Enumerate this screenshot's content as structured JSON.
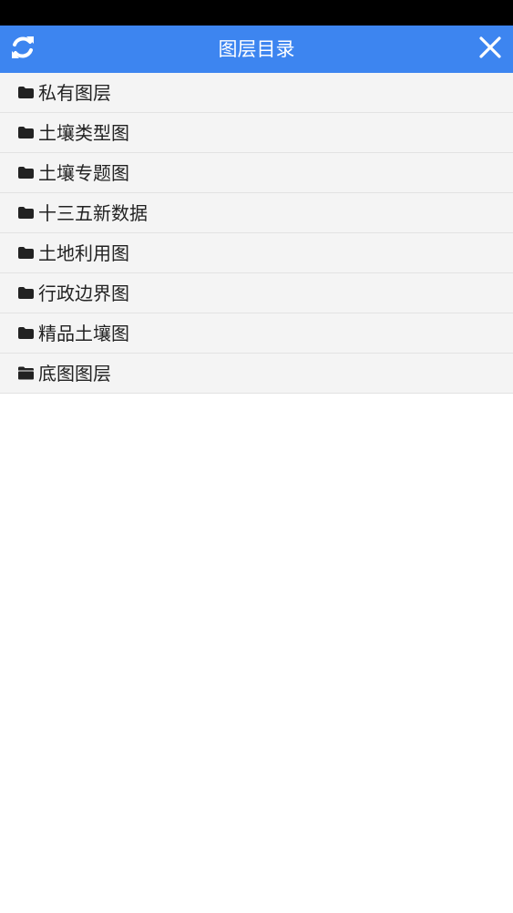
{
  "header": {
    "title": "图层目录",
    "refresh_icon": "refresh-icon",
    "close_icon": "close-icon"
  },
  "colors": {
    "header_bg": "#3d85f0",
    "status_bar": "#000000",
    "item_bg": "#f4f4f4",
    "divider": "#e2e2e2",
    "text": "#222222"
  },
  "layers": {
    "items": [
      {
        "label": "私有图层",
        "icon": "folder-icon"
      },
      {
        "label": "土壤类型图",
        "icon": "folder-icon"
      },
      {
        "label": "土壤专题图",
        "icon": "folder-icon"
      },
      {
        "label": "十三五新数据",
        "icon": "folder-icon"
      },
      {
        "label": "土地利用图",
        "icon": "folder-icon"
      },
      {
        "label": "行政边界图",
        "icon": "folder-icon"
      },
      {
        "label": "精品土壤图",
        "icon": "folder-icon"
      },
      {
        "label": "底图图层",
        "icon": "folder-open-icon"
      }
    ]
  }
}
